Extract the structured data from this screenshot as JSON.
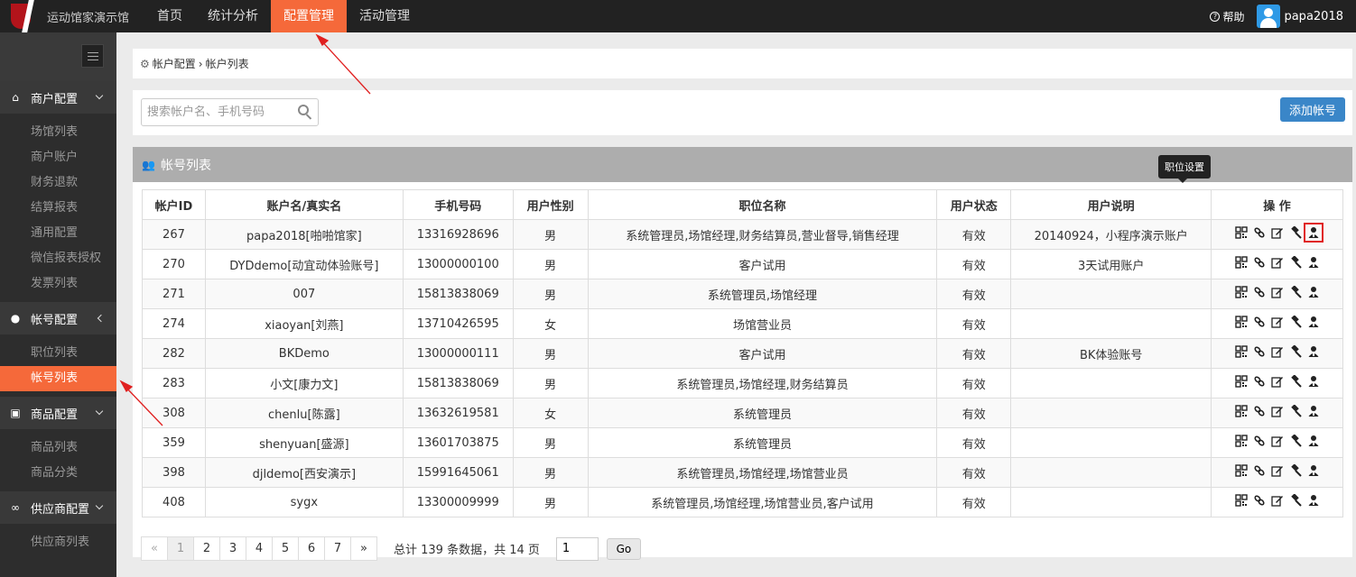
{
  "brand": {
    "name": "运动馆家演示馆"
  },
  "nav": [
    {
      "label": "首页",
      "active": false
    },
    {
      "label": "统计分析",
      "active": false
    },
    {
      "label": "配置管理",
      "active": true
    },
    {
      "label": "活动管理",
      "active": false
    }
  ],
  "top_right": {
    "help_label": "帮助",
    "username": "papa2018"
  },
  "sidebar": {
    "groups": [
      {
        "label": "商户配置",
        "icon": "home-icon",
        "items": [
          "场馆列表",
          "商户账户",
          "财务退款",
          "结算报表",
          "通用配置",
          "微信报表授权",
          "发票列表"
        ]
      },
      {
        "label": "帐号配置",
        "icon": "user-icon",
        "items": [
          "职位列表",
          "帐号列表"
        ],
        "active_item": "帐号列表"
      },
      {
        "label": "商品配置",
        "icon": "gift-icon",
        "items": [
          "商品列表",
          "商品分类"
        ]
      },
      {
        "label": "供应商配置",
        "icon": "link-icon",
        "items": [
          "供应商列表"
        ]
      }
    ]
  },
  "breadcrumb": {
    "part1": "帐户配置",
    "separator": "›",
    "part2": "帐户列表"
  },
  "search": {
    "placeholder": "搜索帐户名、手机号码"
  },
  "add_button": {
    "label": "添加帐号"
  },
  "panel": {
    "title": "帐号列表"
  },
  "table": {
    "headers": [
      "帐户ID",
      "账户名/真实名",
      "手机号码",
      "用户性别",
      "职位名称",
      "用户状态",
      "用户说明",
      "操  作"
    ],
    "rows": [
      [
        "267",
        "papa2018[啪啪馆家]",
        "13316928696",
        "男",
        "系统管理员,场馆经理,财务结算员,营业督导,销售经理",
        "有效",
        "20140924，小程序演示账户"
      ],
      [
        "270",
        "DYDdemo[动宜动体验账号]",
        "13000000100",
        "男",
        "客户试用",
        "有效",
        "3天试用账户"
      ],
      [
        "271",
        "007",
        "15813838069",
        "男",
        "系统管理员,场馆经理",
        "有效",
        ""
      ],
      [
        "274",
        "xiaoyan[刘燕]",
        "13710426595",
        "女",
        "场馆营业员",
        "有效",
        ""
      ],
      [
        "282",
        "BKDemo",
        "13000000111",
        "男",
        "客户试用",
        "有效",
        "BK体验账号"
      ],
      [
        "283",
        "小文[康力文]",
        "15813838069",
        "男",
        "系统管理员,场馆经理,财务结算员",
        "有效",
        ""
      ],
      [
        "308",
        "chenlu[陈露]",
        "13632619581",
        "女",
        "系统管理员",
        "有效",
        ""
      ],
      [
        "359",
        "shenyuan[盛源]",
        "13601703875",
        "男",
        "系统管理员",
        "有效",
        ""
      ],
      [
        "398",
        "djldemo[西安演示]",
        "15991645061",
        "男",
        "系统管理员,场馆经理,场馆营业员",
        "有效",
        ""
      ],
      [
        "408",
        "sygx",
        "13300009999",
        "男",
        "系统管理员,场馆经理,场馆营业员,客户试用",
        "有效",
        ""
      ]
    ]
  },
  "tooltip": {
    "text": "职位设置"
  },
  "pagination": {
    "prev": "«",
    "pages": [
      "1",
      "2",
      "3",
      "4",
      "5",
      "6",
      "7"
    ],
    "next": "»",
    "current": "1",
    "info": "总计 139 条数据，共 14 页",
    "input_value": "1",
    "go_label": "Go"
  },
  "colors": {
    "accent": "#f5693a",
    "primary_button": "#3a86c8",
    "topbar": "#222222",
    "sidebar": "#2d2d2d",
    "annotation": "#e02020"
  }
}
